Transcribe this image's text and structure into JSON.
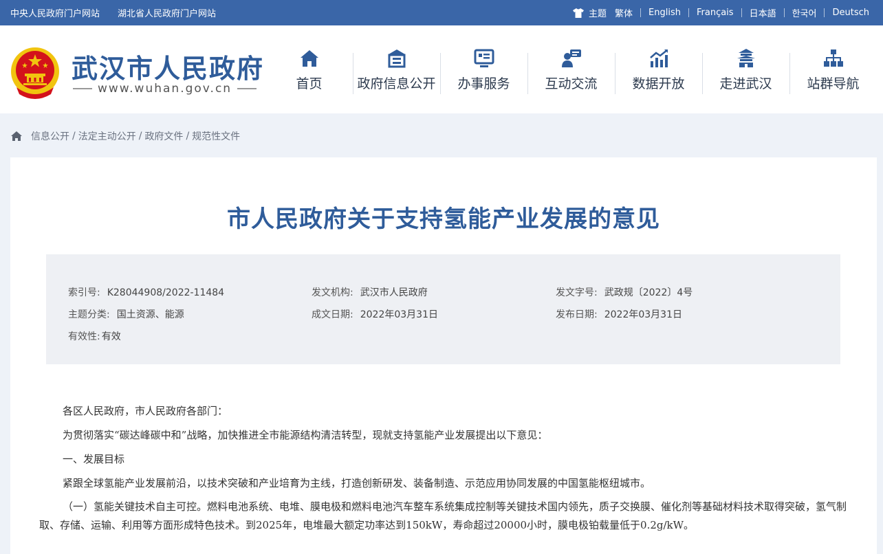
{
  "topbar": {
    "left_links": [
      "中央人民政府门户网站",
      "湖北省人民政府门户网站"
    ],
    "theme_label": "主题",
    "languages": [
      "繁体",
      "English",
      "Français",
      "日本語",
      "한국어",
      "Deutsch"
    ]
  },
  "header": {
    "site_name": "武汉市人民政府",
    "site_url": "www.wuhan.gov.cn",
    "nav": [
      {
        "label": "首页",
        "icon": "home-icon"
      },
      {
        "label": "政府信息公开",
        "icon": "building-icon"
      },
      {
        "label": "办事服务",
        "icon": "monitor-icon"
      },
      {
        "label": "互动交流",
        "icon": "chat-user-icon"
      },
      {
        "label": "数据开放",
        "icon": "chart-icon"
      },
      {
        "label": "走进武汉",
        "icon": "pavilion-icon"
      },
      {
        "label": "站群导航",
        "icon": "sitemap-icon"
      }
    ]
  },
  "breadcrumb": [
    "信息公开",
    "法定主动公开",
    "政府文件",
    "规范性文件"
  ],
  "article": {
    "title": "市人民政府关于支持氢能产业发展的意见",
    "meta": {
      "index_no_label": "索引号:",
      "index_no": "K28044908/2022-11484",
      "issuer_label": "发文机构:",
      "issuer": "武汉市人民政府",
      "doc_no_label": "发文字号:",
      "doc_no": "武政规〔2022〕4号",
      "topic_label": "主题分类:",
      "topic": "国土资源、能源",
      "date_made_label": "成文日期:",
      "date_made": "2022年03月31日",
      "date_pub_label": "发布日期:",
      "date_pub": "2022年03月31日",
      "validity_label": "有效性:",
      "validity": "有效"
    },
    "paragraphs": [
      "各区人民政府，市人民政府各部门：",
      "为贯彻落实“碳达峰碳中和”战略，加快推进全市能源结构清洁转型，现就支持氢能产业发展提出以下意见：",
      "一、发展目标",
      "紧跟全球氢能产业发展前沿，以技术突破和产业培育为主线，打造创新研发、装备制造、示范应用协同发展的中国氢能枢纽城市。",
      "（一）氢能关键技术自主可控。燃料电池系统、电堆、膜电极和燃料电池汽车整车系统集成控制等关键技术国内领先，质子交换膜、催化剂等基础材料技术取得突破，氢气制取、存储、运输、利用等方面形成特色技术。到2025年，电堆最大额定功率达到150kW，寿命超过20000小时，膜电极铂载量低于0.2g/kW。"
    ]
  },
  "colors": {
    "topbar_bg": "#3a66a8",
    "brand_blue": "#2f5c9a",
    "emblem_red": "#d3121b",
    "emblem_gold": "#f1c40f"
  }
}
